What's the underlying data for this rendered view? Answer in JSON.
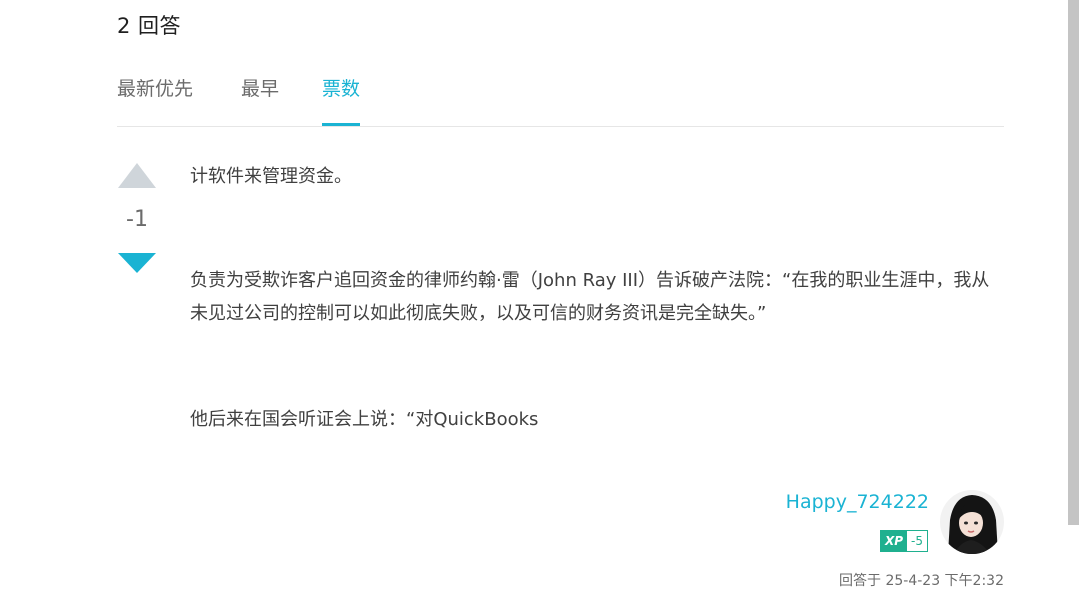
{
  "answers_header": {
    "count_label": "2 回答"
  },
  "sort_tabs": [
    {
      "label": "最新优先",
      "active": false
    },
    {
      "label": "最早",
      "active": false
    },
    {
      "label": "票数",
      "active": true
    }
  ],
  "vote": {
    "score": "-1"
  },
  "answer": {
    "paragraphs": [
      "计软件来管理资金。",
      "负责为受欺诈客户追回资金的律师约翰·雷（John Ray III）告诉破产法院：“在我的职业生涯中，我从未见过公司的控制可以如此彻底失败，以及可信的财务资讯是完全缺失。”",
      "他后来在国会听证会上说：“对QuickBooks"
    ]
  },
  "author": {
    "name": "Happy_724222",
    "xp_label": "XP",
    "xp_value": "-5",
    "answered_at": "回答于 25-4-23 下午2:32"
  },
  "colors": {
    "accent": "#1ab3d3",
    "xp_green": "#1fb08f",
    "upvote_inactive": "#cfd5da"
  }
}
